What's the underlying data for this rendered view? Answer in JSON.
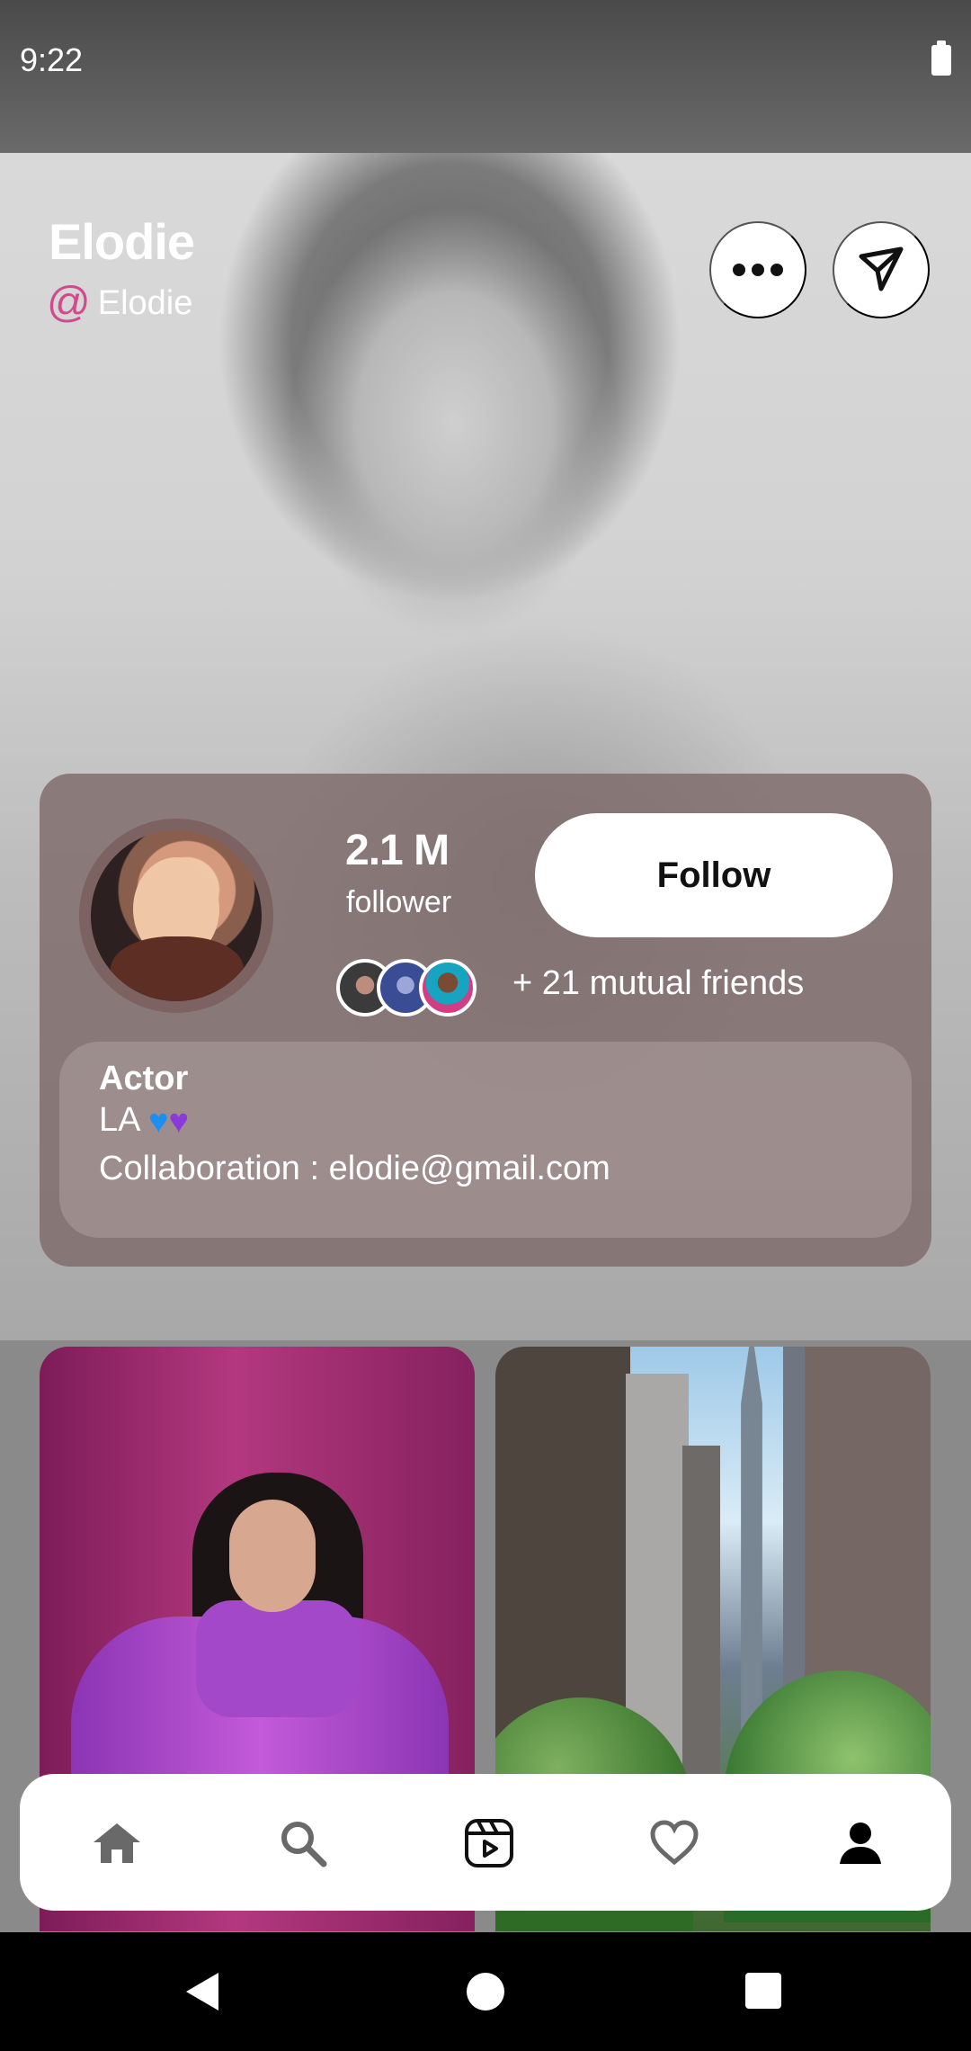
{
  "status_bar": {
    "time": "9:22"
  },
  "profile": {
    "name": "Elodie",
    "handle": "Elodie"
  },
  "stats": {
    "follower_count": "2.1 M",
    "follower_label": "follower",
    "follow_label": "Follow",
    "mutual_friends": "+ 21 mutual friends"
  },
  "bio": {
    "title": "Actor",
    "location": "LA",
    "contact": "Collaboration : elodie@gmail.com"
  },
  "icons": {
    "more": "more-icon",
    "send": "send-icon",
    "home": "home-icon",
    "search": "search-icon",
    "reels": "reels-icon",
    "likes": "heart-icon",
    "profile": "profile-icon"
  },
  "colors": {
    "accent_pink": "#d2498d",
    "blue_heart": "#1b8ff2",
    "purple_heart": "#8b39d9",
    "card": "#7e6a6a"
  }
}
